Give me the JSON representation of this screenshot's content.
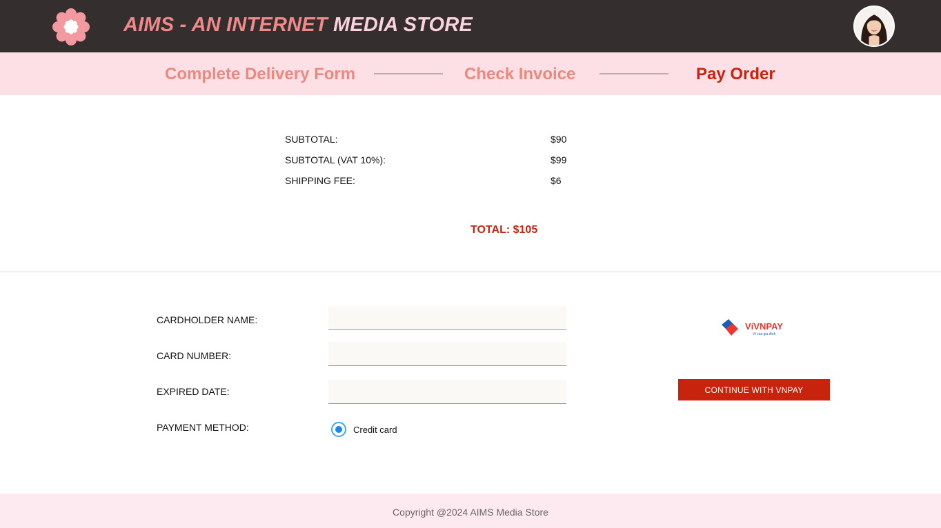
{
  "header": {
    "title_part1": "AIMS - AN INTERNET ",
    "title_part2": "MEDIA STORE",
    "logo_icon": "flower-logo-icon",
    "avatar_icon": "user-avatar",
    "brand_colors": {
      "header_bg": "#342e2f",
      "accent": "#c8240d",
      "soft_pink": "#fde0e6"
    }
  },
  "steps": [
    {
      "label": "Complete Delivery Form",
      "state": "done"
    },
    {
      "label": "Check Invoice",
      "state": "done"
    },
    {
      "label": "Pay Order",
      "state": "active"
    }
  ],
  "invoice": {
    "rows": [
      {
        "label": "SUBTOTAL:",
        "value": "$90"
      },
      {
        "label": "SUBTOTAL (VAT 10%):",
        "value": "$99"
      },
      {
        "label": "SHIPPING FEE:",
        "value": "$6"
      }
    ],
    "total": "TOTAL: $105"
  },
  "payment_form": {
    "cardholder_label": "CARDHOLDER NAME:",
    "cardholder_value": "",
    "card_number_label": "CARD NUMBER:",
    "card_number_value": "",
    "expired_date_label": "EXPIRED DATE:",
    "expired_date_value": "",
    "method_label": "PAYMENT METHOD:",
    "method_option": "Credit card"
  },
  "vnpay": {
    "logo_text": "VíVNPAY",
    "logo_tagline": "Ví của gia đình",
    "button_label": "CONTINUE WITH VNPAY"
  },
  "footer": {
    "copyright": "Copyright @2024 AIMS Media Store"
  }
}
